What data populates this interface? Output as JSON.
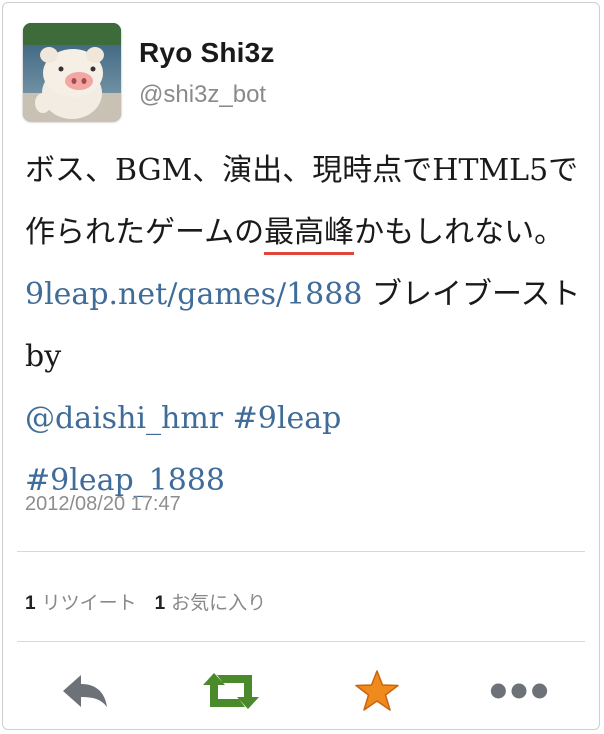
{
  "user": {
    "name": "Ryo Shi3z",
    "handle": "@shi3z_bot"
  },
  "tweet": {
    "part1": "ボス、BGM、演出、現時点でHTML5で作られたゲームの",
    "highlight": "最高峰",
    "part2": "かもしれない。 ",
    "link": "9leap.net/games/1888",
    "part3": " ブレイブースト by ",
    "mention": "@daishi_hmr",
    "hashtag1": "#9leap",
    "hashtag2": "#9leap_1888",
    "highlight_color": "#e0463a",
    "link_color": "#3f6c99"
  },
  "timestamp": "2012/08/20 17:47",
  "stats": {
    "retweets_count": "1",
    "retweets_label": "リツイート",
    "favorites_count": "1",
    "favorites_label": "お気に入り"
  },
  "actions": [
    {
      "icon": "reply-icon"
    },
    {
      "icon": "retweet-icon",
      "color": "#4a8a2a"
    },
    {
      "icon": "favorite-star-icon",
      "color": "#f08a1c"
    },
    {
      "icon": "more-icon"
    }
  ]
}
